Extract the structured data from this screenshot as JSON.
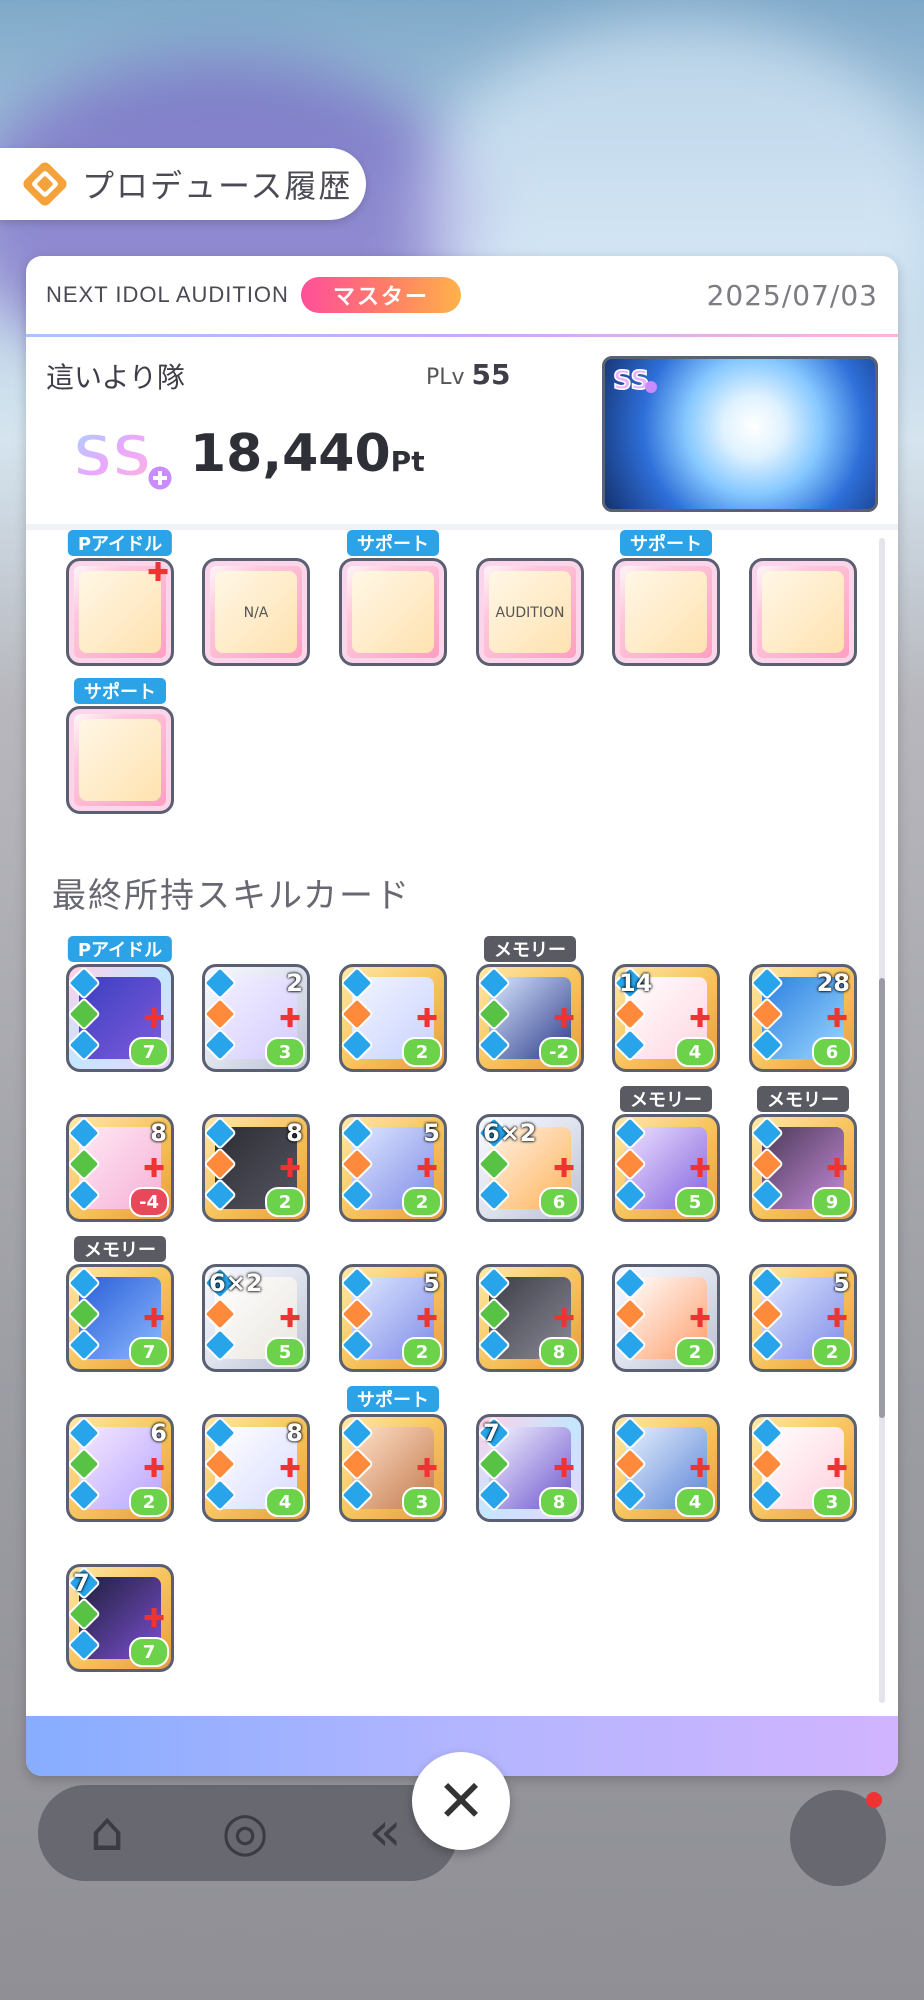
{
  "header": {
    "title": "プロデュース履歴"
  },
  "record": {
    "audition": "NEXT IDOL AUDITION",
    "rank": "マスター",
    "date": "2025/07/03",
    "unit_name": "這いより隊",
    "plv_label": "PLv",
    "plv_value": "55",
    "score": "18,440",
    "score_unit": "Pt"
  },
  "items": [
    {
      "tag": "Pアイドル",
      "icon": "pouch-icon"
    },
    {
      "tag": "",
      "icon": "tag-icon",
      "glyph": "N/A"
    },
    {
      "tag": "サポート",
      "icon": "cloth-icon"
    },
    {
      "tag": "",
      "icon": "badge-icon",
      "glyph": "AUDITION"
    },
    {
      "tag": "サポート",
      "icon": "candle-icon"
    },
    {
      "tag": "",
      "icon": "bracelet-icon"
    },
    {
      "tag": "サポート",
      "icon": "star-chain-icon"
    }
  ],
  "skills_title": "最終所持スキルカード",
  "skills": [
    {
      "tag": "Pアイドル",
      "top": "",
      "cost": "7",
      "cost_color": "green"
    },
    {
      "tag": "",
      "top": "2",
      "cost": "3",
      "cost_color": "green"
    },
    {
      "tag": "",
      "top": "",
      "cost": "2",
      "cost_color": "green"
    },
    {
      "tag": "メモリー",
      "top": "",
      "cost": "-2",
      "cost_color": "green"
    },
    {
      "tag": "",
      "top": "14",
      "top_left": true,
      "cost": "4",
      "cost_color": "green"
    },
    {
      "tag": "",
      "top": "28",
      "cost": "6",
      "cost_color": "green"
    },
    {
      "tag": "",
      "top": "8",
      "cost": "-4",
      "cost_color": "red"
    },
    {
      "tag": "",
      "top": "8",
      "cost": "2",
      "cost_color": "green"
    },
    {
      "tag": "",
      "top": "5",
      "cost": "2",
      "cost_color": "green"
    },
    {
      "tag": "",
      "top": "6×2",
      "top_left": true,
      "cost": "6",
      "cost_color": "green"
    },
    {
      "tag": "メモリー",
      "top": "",
      "cost": "5",
      "cost_color": "green"
    },
    {
      "tag": "メモリー",
      "top": "",
      "cost": "9",
      "cost_color": "green"
    },
    {
      "tag": "メモリー",
      "top": "",
      "cost": "7",
      "cost_color": "green"
    },
    {
      "tag": "",
      "top": "6×2",
      "top_left": true,
      "cost": "5",
      "cost_color": "green"
    },
    {
      "tag": "",
      "top": "5",
      "cost": "2",
      "cost_color": "green"
    },
    {
      "tag": "",
      "top": "",
      "cost": "8",
      "cost_color": "green"
    },
    {
      "tag": "",
      "top": "",
      "cost": "2",
      "cost_color": "green"
    },
    {
      "tag": "",
      "top": "5",
      "cost": "2",
      "cost_color": "green"
    },
    {
      "tag": "",
      "top": "6",
      "cost": "2",
      "cost_color": "green"
    },
    {
      "tag": "",
      "top": "8",
      "cost": "4",
      "cost_color": "green"
    },
    {
      "tag": "サポート",
      "top": "",
      "cost": "3",
      "cost_color": "green"
    },
    {
      "tag": "",
      "top": "7",
      "top_left": true,
      "cost": "8",
      "cost_color": "green"
    },
    {
      "tag": "",
      "top": "",
      "cost": "4",
      "cost_color": "green"
    },
    {
      "tag": "",
      "top": "",
      "cost": "3",
      "cost_color": "green"
    },
    {
      "tag": "",
      "top": "7",
      "top_left": true,
      "cost": "7",
      "cost_color": "green"
    }
  ],
  "nav": {
    "icons": [
      "home-icon",
      "shop-icon",
      "back-icon",
      "menu-icon"
    ]
  }
}
